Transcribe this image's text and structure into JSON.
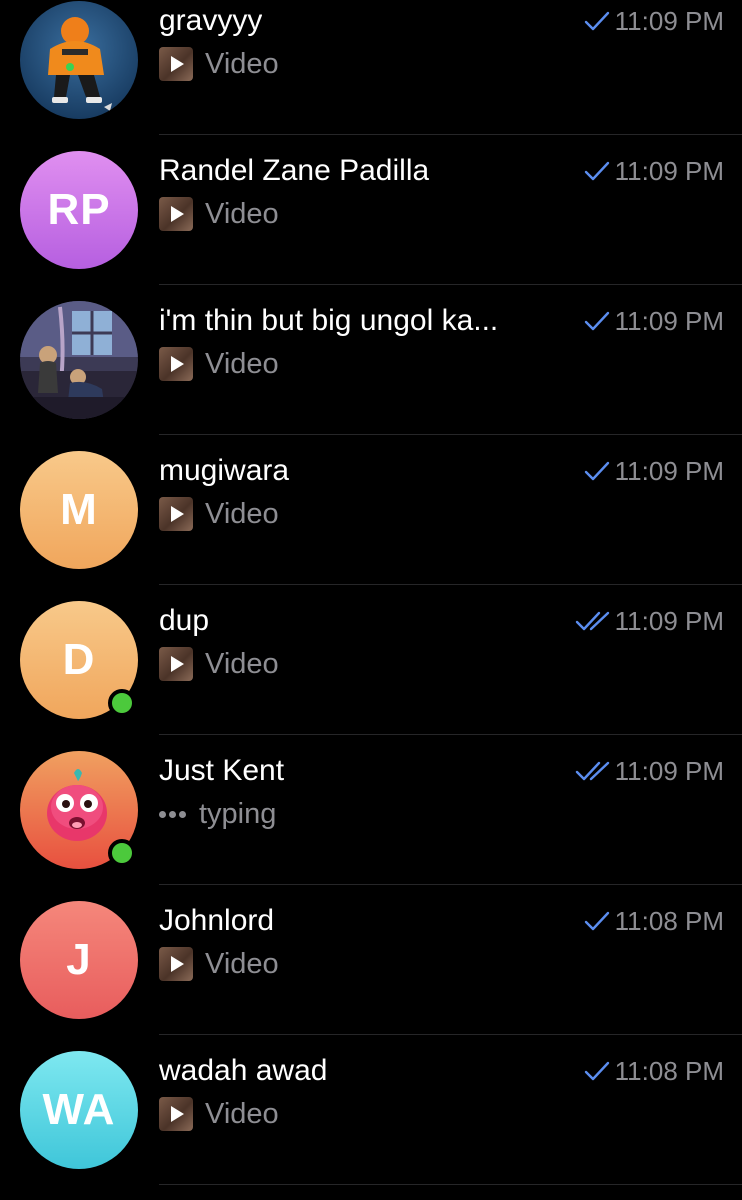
{
  "chats": [
    {
      "name": "gravyyy",
      "preview": "Video",
      "time": "11:09 PM",
      "read": "single",
      "avatar": {
        "type": "photo",
        "photo": "person-orange-hoodie"
      },
      "online": false
    },
    {
      "name": "Randel Zane Padilla",
      "preview": "Video",
      "time": "11:09 PM",
      "read": "single",
      "avatar": {
        "type": "initials",
        "initials": "RP",
        "colors": [
          "#e08ff0",
          "#b65fe0"
        ]
      },
      "online": false
    },
    {
      "name": "i'm thin but big ungol ka...",
      "preview": "Video",
      "time": "11:09 PM",
      "read": "single",
      "avatar": {
        "type": "photo",
        "photo": "anime-room-scene"
      },
      "online": false
    },
    {
      "name": "mugiwara",
      "preview": "Video",
      "time": "11:09 PM",
      "read": "single",
      "avatar": {
        "type": "initials",
        "initials": "M",
        "colors": [
          "#f8c98a",
          "#f0a65c"
        ]
      },
      "online": false
    },
    {
      "name": "dup",
      "preview": "Video",
      "time": "11:09 PM",
      "read": "double",
      "avatar": {
        "type": "initials",
        "initials": "D",
        "colors": [
          "#f8c98a",
          "#f0a65c"
        ]
      },
      "online": true
    },
    {
      "name": "Just Kent",
      "preview": "typing",
      "time": "11:09 PM",
      "read": "double",
      "typing": true,
      "avatar": {
        "type": "photo",
        "photo": "pink-cartoon-creature"
      },
      "online": true
    },
    {
      "name": "Johnlord",
      "preview": "Video",
      "time": "11:08 PM",
      "read": "single",
      "avatar": {
        "type": "initials",
        "initials": "J",
        "colors": [
          "#f5877b",
          "#e85d5d"
        ]
      },
      "online": false
    },
    {
      "name": "wadah awad",
      "preview": "Video",
      "time": "11:08 PM",
      "read": "single",
      "avatar": {
        "type": "initials",
        "initials": "WA",
        "colors": [
          "#7ee8f0",
          "#3fc6d9"
        ]
      },
      "online": false
    }
  ],
  "colors": {
    "background": "#000000",
    "name": "#ffffff",
    "secondary": "#8e8e93",
    "check": "#5b8def",
    "online": "#4cc93c",
    "separator": "#262628"
  },
  "icons": {
    "read_single": "check-icon",
    "read_double": "double-check-icon",
    "media": "video-thumbnail-icon"
  }
}
